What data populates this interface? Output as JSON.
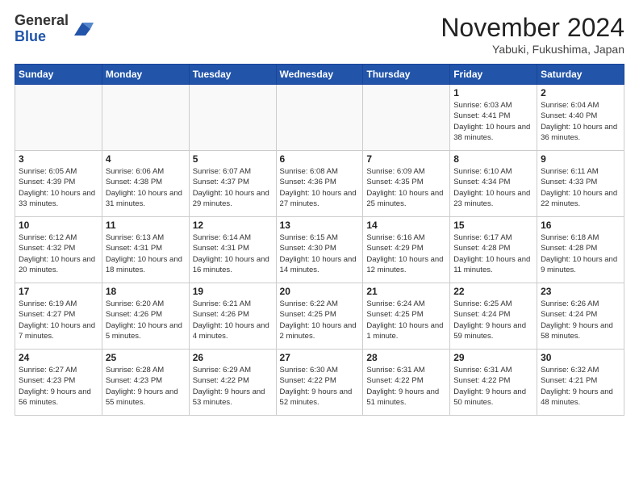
{
  "logo": {
    "general": "General",
    "blue": "Blue"
  },
  "title": "November 2024",
  "location": "Yabuki, Fukushima, Japan",
  "days_of_week": [
    "Sunday",
    "Monday",
    "Tuesday",
    "Wednesday",
    "Thursday",
    "Friday",
    "Saturday"
  ],
  "weeks": [
    [
      {
        "day": "",
        "info": ""
      },
      {
        "day": "",
        "info": ""
      },
      {
        "day": "",
        "info": ""
      },
      {
        "day": "",
        "info": ""
      },
      {
        "day": "",
        "info": ""
      },
      {
        "day": "1",
        "info": "Sunrise: 6:03 AM\nSunset: 4:41 PM\nDaylight: 10 hours and 38 minutes."
      },
      {
        "day": "2",
        "info": "Sunrise: 6:04 AM\nSunset: 4:40 PM\nDaylight: 10 hours and 36 minutes."
      }
    ],
    [
      {
        "day": "3",
        "info": "Sunrise: 6:05 AM\nSunset: 4:39 PM\nDaylight: 10 hours and 33 minutes."
      },
      {
        "day": "4",
        "info": "Sunrise: 6:06 AM\nSunset: 4:38 PM\nDaylight: 10 hours and 31 minutes."
      },
      {
        "day": "5",
        "info": "Sunrise: 6:07 AM\nSunset: 4:37 PM\nDaylight: 10 hours and 29 minutes."
      },
      {
        "day": "6",
        "info": "Sunrise: 6:08 AM\nSunset: 4:36 PM\nDaylight: 10 hours and 27 minutes."
      },
      {
        "day": "7",
        "info": "Sunrise: 6:09 AM\nSunset: 4:35 PM\nDaylight: 10 hours and 25 minutes."
      },
      {
        "day": "8",
        "info": "Sunrise: 6:10 AM\nSunset: 4:34 PM\nDaylight: 10 hours and 23 minutes."
      },
      {
        "day": "9",
        "info": "Sunrise: 6:11 AM\nSunset: 4:33 PM\nDaylight: 10 hours and 22 minutes."
      }
    ],
    [
      {
        "day": "10",
        "info": "Sunrise: 6:12 AM\nSunset: 4:32 PM\nDaylight: 10 hours and 20 minutes."
      },
      {
        "day": "11",
        "info": "Sunrise: 6:13 AM\nSunset: 4:31 PM\nDaylight: 10 hours and 18 minutes."
      },
      {
        "day": "12",
        "info": "Sunrise: 6:14 AM\nSunset: 4:31 PM\nDaylight: 10 hours and 16 minutes."
      },
      {
        "day": "13",
        "info": "Sunrise: 6:15 AM\nSunset: 4:30 PM\nDaylight: 10 hours and 14 minutes."
      },
      {
        "day": "14",
        "info": "Sunrise: 6:16 AM\nSunset: 4:29 PM\nDaylight: 10 hours and 12 minutes."
      },
      {
        "day": "15",
        "info": "Sunrise: 6:17 AM\nSunset: 4:28 PM\nDaylight: 10 hours and 11 minutes."
      },
      {
        "day": "16",
        "info": "Sunrise: 6:18 AM\nSunset: 4:28 PM\nDaylight: 10 hours and 9 minutes."
      }
    ],
    [
      {
        "day": "17",
        "info": "Sunrise: 6:19 AM\nSunset: 4:27 PM\nDaylight: 10 hours and 7 minutes."
      },
      {
        "day": "18",
        "info": "Sunrise: 6:20 AM\nSunset: 4:26 PM\nDaylight: 10 hours and 5 minutes."
      },
      {
        "day": "19",
        "info": "Sunrise: 6:21 AM\nSunset: 4:26 PM\nDaylight: 10 hours and 4 minutes."
      },
      {
        "day": "20",
        "info": "Sunrise: 6:22 AM\nSunset: 4:25 PM\nDaylight: 10 hours and 2 minutes."
      },
      {
        "day": "21",
        "info": "Sunrise: 6:24 AM\nSunset: 4:25 PM\nDaylight: 10 hours and 1 minute."
      },
      {
        "day": "22",
        "info": "Sunrise: 6:25 AM\nSunset: 4:24 PM\nDaylight: 9 hours and 59 minutes."
      },
      {
        "day": "23",
        "info": "Sunrise: 6:26 AM\nSunset: 4:24 PM\nDaylight: 9 hours and 58 minutes."
      }
    ],
    [
      {
        "day": "24",
        "info": "Sunrise: 6:27 AM\nSunset: 4:23 PM\nDaylight: 9 hours and 56 minutes."
      },
      {
        "day": "25",
        "info": "Sunrise: 6:28 AM\nSunset: 4:23 PM\nDaylight: 9 hours and 55 minutes."
      },
      {
        "day": "26",
        "info": "Sunrise: 6:29 AM\nSunset: 4:22 PM\nDaylight: 9 hours and 53 minutes."
      },
      {
        "day": "27",
        "info": "Sunrise: 6:30 AM\nSunset: 4:22 PM\nDaylight: 9 hours and 52 minutes."
      },
      {
        "day": "28",
        "info": "Sunrise: 6:31 AM\nSunset: 4:22 PM\nDaylight: 9 hours and 51 minutes."
      },
      {
        "day": "29",
        "info": "Sunrise: 6:31 AM\nSunset: 4:22 PM\nDaylight: 9 hours and 50 minutes."
      },
      {
        "day": "30",
        "info": "Sunrise: 6:32 AM\nSunset: 4:21 PM\nDaylight: 9 hours and 48 minutes."
      }
    ]
  ]
}
